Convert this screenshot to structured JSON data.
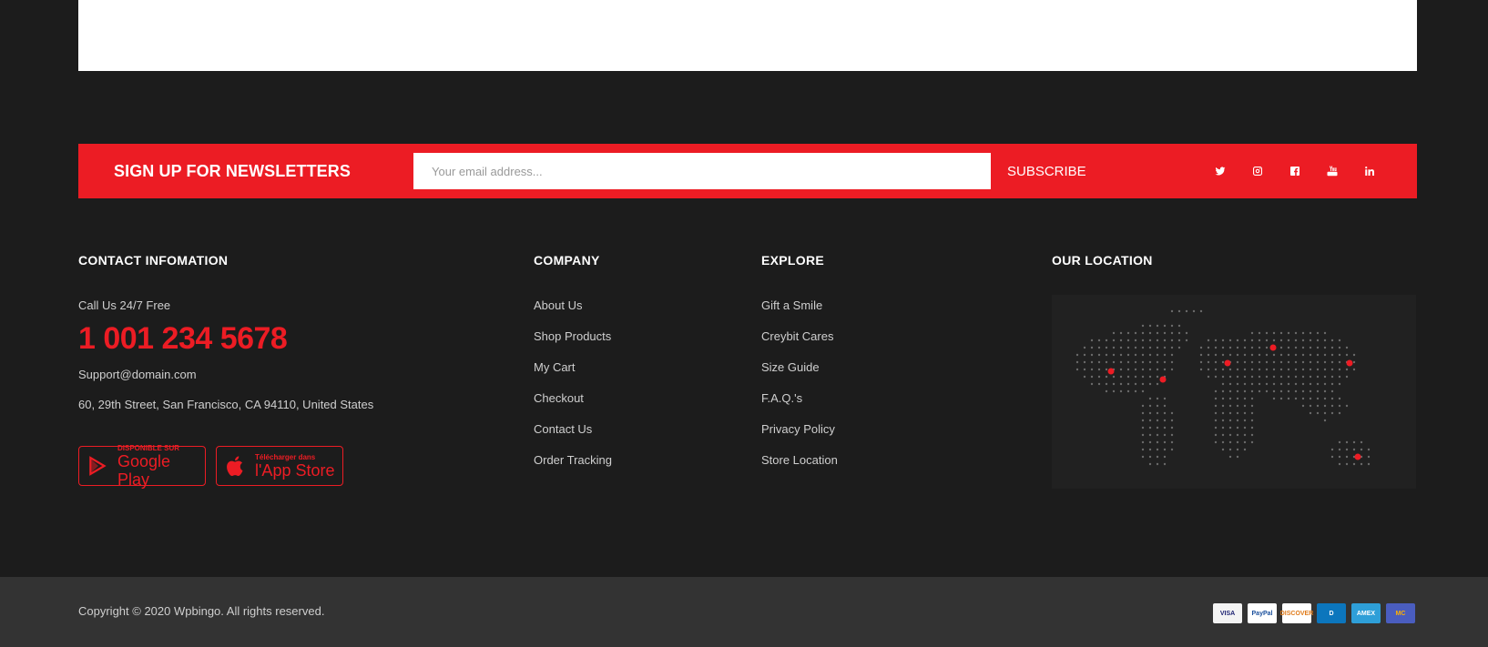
{
  "newsletter": {
    "title": "SIGN UP FOR NEWSLETTERS",
    "placeholder": "Your email address...",
    "button": "SUBSCRIBE",
    "social": [
      "twitter-icon",
      "instagram-icon",
      "facebook-icon",
      "youtube-icon",
      "linkedin-icon"
    ]
  },
  "contact": {
    "title": "CONTACT INFOMATION",
    "call_label": "Call Us 24/7 Free",
    "phone": "1 001 234 5678",
    "email": "Support@domain.com",
    "address": "60, 29th Street, San Francisco, CA 94110, United States",
    "apps": [
      {
        "small": "DISPONIBLE SUR",
        "big": "Google Play"
      },
      {
        "small": "Télécharger dans",
        "big": "l'App Store"
      }
    ]
  },
  "company": {
    "title": "COMPANY",
    "links": [
      "About Us",
      "Shop Products",
      "My Cart",
      "Checkout",
      "Contact Us",
      "Order Tracking"
    ]
  },
  "explore": {
    "title": "EXPLORE",
    "links": [
      "Gift a Smile",
      "Creybit Cares",
      "Size Guide",
      "F.A.Q.'s",
      "Privacy Policy",
      "Store Location"
    ]
  },
  "location": {
    "title": "OUR LOCATION"
  },
  "footer": {
    "copyright": "Copyright © 2020 Wpbingo. All rights reserved.",
    "payments": [
      {
        "label": "VISA",
        "bg": "#f4f4f4",
        "fg": "#1a1f71"
      },
      {
        "label": "PayPal",
        "bg": "#ffffff",
        "fg": "#1a4f9c"
      },
      {
        "label": "DISCOVER",
        "bg": "#ffffff",
        "fg": "#e07b1a"
      },
      {
        "label": "D",
        "bg": "#0c76bd",
        "fg": "#ffffff"
      },
      {
        "label": "AMEX",
        "bg": "#2e9fd8",
        "fg": "#ffffff"
      },
      {
        "label": "MC",
        "bg": "#4a5dbf",
        "fg": "#ffb000"
      }
    ]
  },
  "colors": {
    "accent": "#ec1c24",
    "background": "#1c1c1c",
    "bottom_bar": "#333333"
  }
}
